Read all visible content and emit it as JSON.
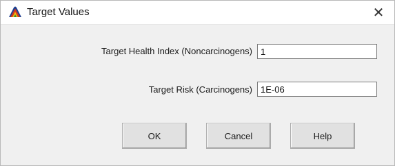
{
  "window": {
    "title": "Target Values",
    "close_glyph": "✕",
    "icon": "app-logo-icon"
  },
  "form": {
    "health_index": {
      "label": "Target Health Index (Noncarcinogens)",
      "value": "1"
    },
    "risk": {
      "label": "Target Risk (Carcinogens)",
      "value": "1E-06"
    }
  },
  "buttons": {
    "ok": "OK",
    "cancel": "Cancel",
    "help": "Help"
  }
}
